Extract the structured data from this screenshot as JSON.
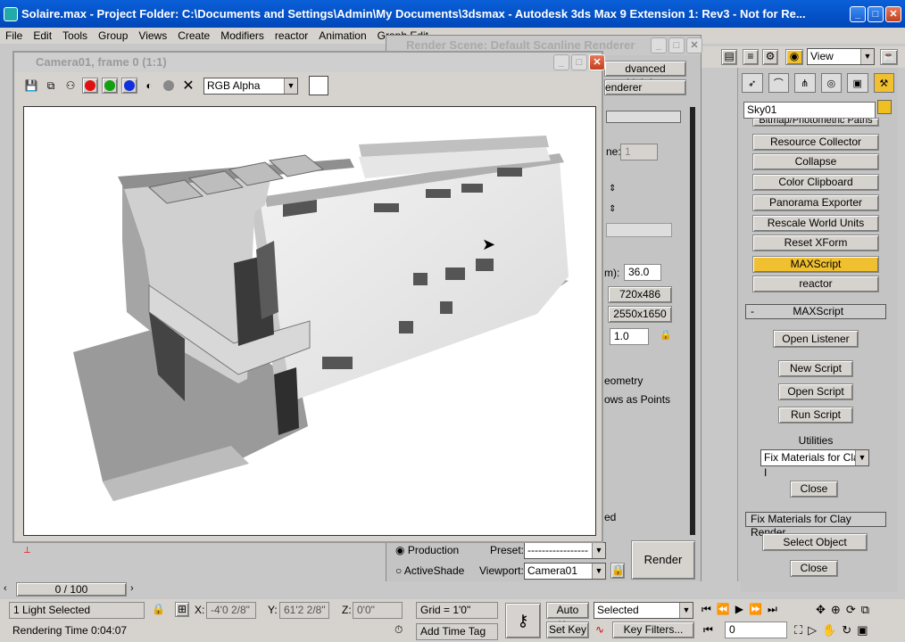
{
  "window": {
    "title": "Solaire.max     - Project Folder: C:\\Documents and Settings\\Admin\\My Documents\\3dsmax     - Autodesk 3ds Max 9 Extension 1: Rev3   - Not for Re..."
  },
  "menu": [
    "File",
    "Edit",
    "Tools",
    "Group",
    "Views",
    "Create",
    "Modifiers",
    "reactor",
    "Animation",
    "Graph Edit"
  ],
  "toolbar": {
    "view_select": "View"
  },
  "frame_window": {
    "title": "Camera01, frame 0 (1:1)",
    "channel_select": "RGB Alpha",
    "colors": {
      "red": "#e01010",
      "green": "#10a010",
      "blue": "#1030e0"
    }
  },
  "render_dialog": {
    "title": "Render Scene: Default Scanline Renderer",
    "tabs": [
      "dvanced Lighting",
      "enderer"
    ],
    "field_1": "1",
    "aperture_label": "m):",
    "aperture_value": "36.0",
    "size_buttons": [
      "720x486",
      "2550x1650"
    ],
    "aspect_value": "1.0",
    "options": [
      "eometry",
      "ows as Points"
    ],
    "ed_text": "ed",
    "mode_production": "Production",
    "mode_activeshade": "ActiveShade",
    "preset_label": "Preset:",
    "preset_value": "-----------------",
    "viewport_label": "Viewport:",
    "viewport_value": "Camera01",
    "render_button": "Render"
  },
  "command_panel": {
    "object_name": "Sky01",
    "partial_top": "Bitmap/Photometric Paths",
    "utility_buttons": [
      "Resource Collector",
      "Collapse",
      "Color Clipboard",
      "Panorama Exporter",
      "Rescale World Units",
      "Reset XForm",
      "MAXScript",
      "reactor"
    ],
    "active_utility": "MAXScript",
    "maxscript_rollout": "MAXScript",
    "maxscript_buttons": [
      "Open Listener",
      "New Script",
      "Open Script",
      "Run Script"
    ],
    "utilities_label": "Utilities",
    "utilities_select": "Fix Materials for Clay I",
    "close_label": "Close",
    "fix_rollout": "Fix Materials for Clay Render",
    "select_object": "Select Object",
    "close_label_2": "Close"
  },
  "timeline": {
    "counter": "0 / 100"
  },
  "status": {
    "selection": "1 Light Selected",
    "render_time": "Rendering Time  0:04:07",
    "x_label": "X:",
    "x_value": "-4'0 2/8\"",
    "y_label": "Y:",
    "y_value": "61'2 2/8\"",
    "z_label": "Z:",
    "z_value": "0'0\"",
    "grid": "Grid = 1'0\"",
    "add_time_tag": "Add Time Tag",
    "auto_key": "Auto Key",
    "set_key": "Set Key",
    "key_mode": "Selected",
    "key_filters": "Key Filters...",
    "frame": "0"
  }
}
